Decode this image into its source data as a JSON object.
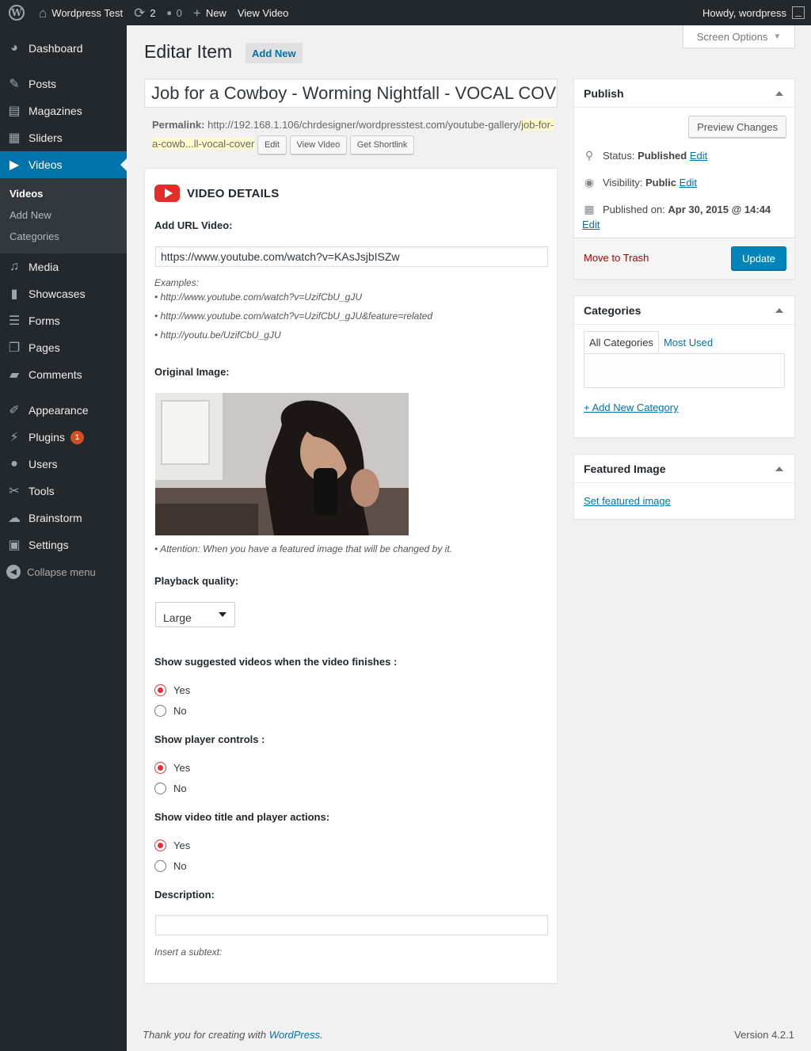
{
  "adminbar": {
    "site_name": "Wordpress Test",
    "updates_count": "2",
    "comments_count": "0",
    "new_label": "New",
    "view_label": "View Video",
    "howdy": "Howdy, wordpress"
  },
  "sidebar": {
    "items": [
      {
        "label": "Dashboard",
        "icon": "dashboard-icon"
      },
      {
        "label": "Posts",
        "icon": "pin-icon"
      },
      {
        "label": "Magazines",
        "icon": "book-icon"
      },
      {
        "label": "Sliders",
        "icon": "slides-icon"
      },
      {
        "label": "Videos",
        "icon": "youtube-icon"
      },
      {
        "label": "Media",
        "icon": "media-icon"
      },
      {
        "label": "Showcases",
        "icon": "showcase-icon"
      },
      {
        "label": "Forms",
        "icon": "forms-icon"
      },
      {
        "label": "Pages",
        "icon": "pages-icon"
      },
      {
        "label": "Comments",
        "icon": "comment-icon"
      },
      {
        "label": "Appearance",
        "icon": "brush-icon"
      },
      {
        "label": "Plugins",
        "icon": "plug-icon"
      },
      {
        "label": "Users",
        "icon": "user-icon"
      },
      {
        "label": "Tools",
        "icon": "wrench-icon"
      },
      {
        "label": "Brainstorm",
        "icon": "brainstorm-icon"
      },
      {
        "label": "Settings",
        "icon": "settings-icon"
      }
    ],
    "submenu": [
      "Videos",
      "Add New",
      "Categories"
    ],
    "plugins_badge": "1",
    "collapse_label": "Collapse menu"
  },
  "screen_options": "Screen Options",
  "page": {
    "title": "Editar Item",
    "add_new": "Add New",
    "post_title": "Job for a Cowboy - Worming Nightfall - VOCAL COVER",
    "permalink_label": "Permalink:",
    "permalink_base": "http://192.168.1.106/chrdesigner/wordpresstest.com/youtube-gallery/",
    "permalink_slug": "job-for-a-cowb...ll-vocal-cover",
    "btn_edit": "Edit",
    "btn_view": "View Video",
    "btn_shortlink": "Get Shortlink"
  },
  "video_details": {
    "heading": "VIDEO DETAILS",
    "url_label": "Add URL Video:",
    "url_value": "https://www.youtube.com/watch?v=KAsJsjbISZw",
    "examples_label": "Examples:",
    "examples": [
      "• http://www.youtube.com/watch?v=UzifCbU_gJU",
      "• http://www.youtube.com/watch?v=UzifCbU_gJU&feature=related",
      "• http://youtu.be/UzifCbU_gJU"
    ],
    "original_image_label": "Original Image:",
    "attention": "• Attention: When you have a featured image that will be changed by it.",
    "quality_label": "Playback quality:",
    "quality_value": "Large",
    "suggested_label": "Show suggested videos when the video finishes :",
    "controls_label": "Show player controls :",
    "title_actions_label": "Show video title and player actions:",
    "yes": "Yes",
    "no": "No",
    "description_label": "Description:",
    "subtext_label": "Insert a subtext:"
  },
  "publish": {
    "heading": "Publish",
    "preview": "Preview Changes",
    "status_label": "Status:",
    "status_value": "Published",
    "visibility_label": "Visibility:",
    "visibility_value": "Public",
    "published_label": "Published on:",
    "published_value": "Apr 30, 2015 @ 14:44",
    "edit": "Edit",
    "trash": "Move to Trash",
    "update": "Update"
  },
  "categories": {
    "heading": "Categories",
    "tab_all": "All Categories",
    "tab_used": "Most Used",
    "add_new": "+ Add New Category"
  },
  "featured": {
    "heading": "Featured Image",
    "set": "Set featured image"
  },
  "footer": {
    "thanks": "Thank you for creating with ",
    "wp_link": "WordPress",
    "period": ".",
    "version": "Version 4.2.1"
  },
  "colors": {
    "admin_dark": "#23282d",
    "accent": "#0073aa",
    "primary_button": "#0085ba",
    "radio_checked": "#dd3333",
    "badge": "#d54e21"
  }
}
